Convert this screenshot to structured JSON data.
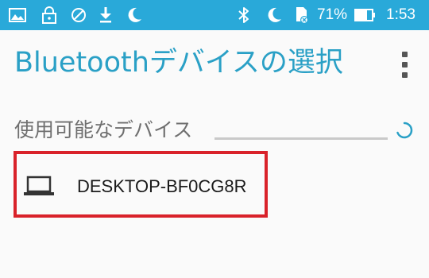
{
  "status_bar": {
    "battery_percent": "71%",
    "time": "1:53",
    "background_color": "#29a9d9",
    "left_icons": [
      "image-icon",
      "lock-icon",
      "blocked-icon",
      "download-icon",
      "moon-icon"
    ],
    "right_icons": [
      "bluetooth-icon",
      "moon-icon",
      "sd-card-error-icon",
      "battery-icon"
    ]
  },
  "app_bar": {
    "title": "Bluetoothデバイスの選択",
    "title_color": "#2aa0c6",
    "menu_icon": "more-vertical-icon"
  },
  "available_section": {
    "title": "使用可能なデバイス",
    "spinner_icon": "loading-spinner-icon"
  },
  "devices": [
    {
      "name": "DESKTOP-BF0CG8R",
      "icon": "laptop-icon",
      "highlight_color": "#d9222a"
    }
  ]
}
